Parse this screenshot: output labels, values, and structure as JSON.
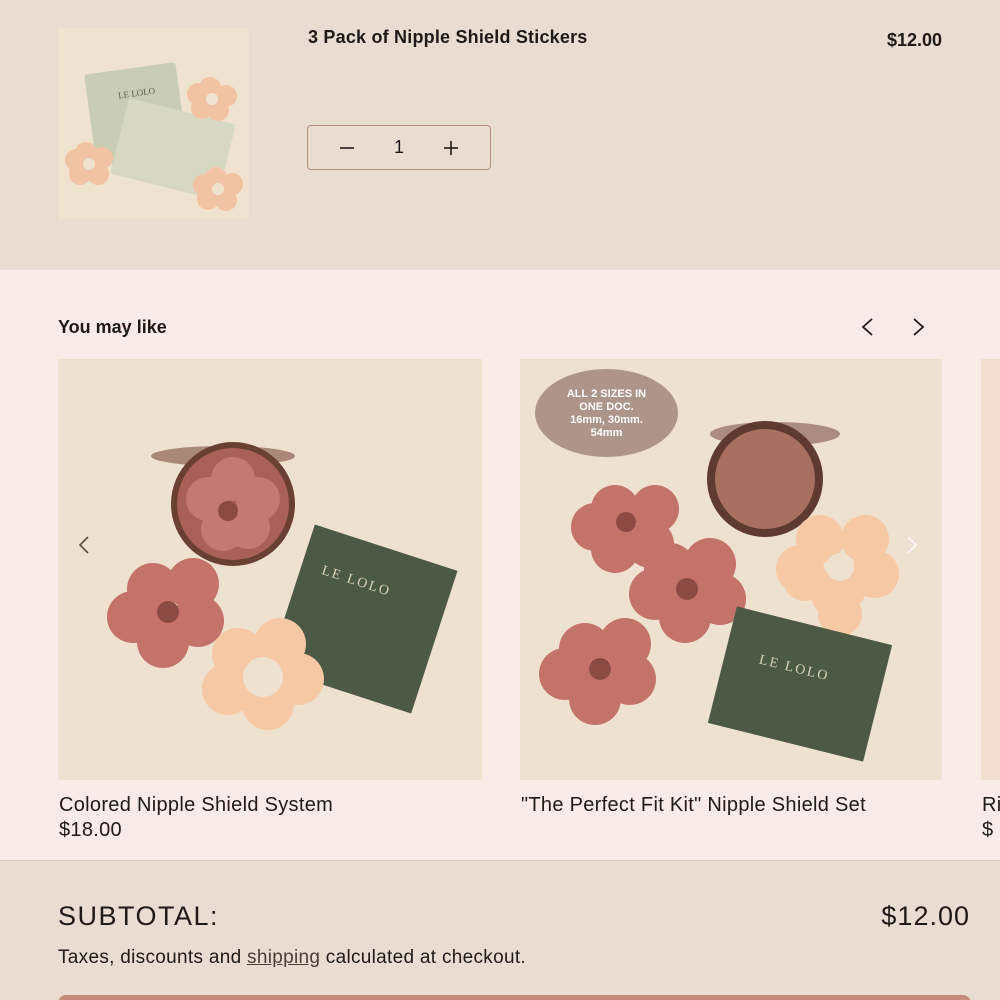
{
  "cart_item": {
    "title": "3 Pack of Nipple Shield Stickers",
    "price": "$12.00",
    "quantity": "1",
    "thumb_brand": "LE LOLO"
  },
  "recommendations": {
    "title": "You may like",
    "products": [
      {
        "name": "Colored Nipple Shield System",
        "price": "$18.00",
        "box_brand": "LE LOLO"
      },
      {
        "name": "\"The Perfect Fit Kit\" Nipple Shield Set",
        "price": "",
        "box_brand": "LE LOLO",
        "badge": [
          "ALL 2 SIZES IN",
          "ONE DOC.",
          "16mm, 30mm.",
          "54mm"
        ]
      },
      {
        "name": "Ri",
        "price": "$"
      }
    ]
  },
  "subtotal": {
    "label": "SUBTOTAL:",
    "value": "$12.00",
    "note_before": "Taxes, discounts and ",
    "note_link": "shipping",
    "note_after": " calculated at checkout."
  },
  "colors": {
    "cart_bg": "#e9ddd2",
    "recs_bg": "#f9ece8",
    "accent": "#c38b7a",
    "badge": "#ad958a"
  }
}
